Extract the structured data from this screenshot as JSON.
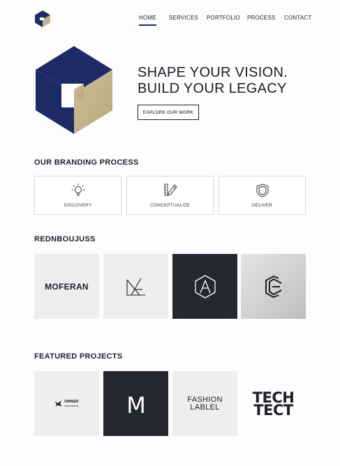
{
  "header": {
    "logo_icon": "hexagon-p-logo",
    "nav": [
      {
        "label": "HOME",
        "active": true
      },
      {
        "label": "SERVICES",
        "active": false
      },
      {
        "label": "PORTFOLIO",
        "active": false
      },
      {
        "label": "PROCESS",
        "active": false
      },
      {
        "label": "CONTACT",
        "active": false
      }
    ]
  },
  "hero": {
    "title_line1": "SHAPE YOUR VISION.",
    "title_line2": "BUILD YOUR LEGACY",
    "cta_label": "EXPLORE OUR WORK",
    "logo_icon": "hexagon-p-logo"
  },
  "process": {
    "title": "OUR BRANDING PROCESS",
    "steps": [
      {
        "label": "DISCOVERY",
        "icon": "lightbulb-icon"
      },
      {
        "label": "CONCEPTUALIZE",
        "icon": "pencil-ruler-icon"
      },
      {
        "label": "DELIVER",
        "icon": "shield-icon"
      }
    ]
  },
  "brands": {
    "title": "REDNBOUJUSS",
    "tiles": [
      {
        "text": "MOFERAN",
        "kind": "wordmark"
      },
      {
        "icon": "mountain-x-icon",
        "kind": "mark"
      },
      {
        "icon": "hexagon-a-icon",
        "kind": "mark"
      },
      {
        "icon": "hexagon-e-icon",
        "kind": "mark"
      }
    ]
  },
  "featured": {
    "title": "FEATURED PROJECTS",
    "tiles": [
      {
        "line1": "DIMMER",
        "line2": "fashionable",
        "icon": "bird-icon"
      },
      {
        "text": "M",
        "icon": "m-monogram-icon"
      },
      {
        "line1": "FASHION",
        "line2": "LABLEL"
      },
      {
        "line1": "TECH",
        "line2": "TECT"
      }
    ]
  },
  "colors": {
    "navy": "#1e2a66",
    "gold": "#c2b28c",
    "dark_tile": "#252830",
    "light_tile": "#eeeeee"
  }
}
